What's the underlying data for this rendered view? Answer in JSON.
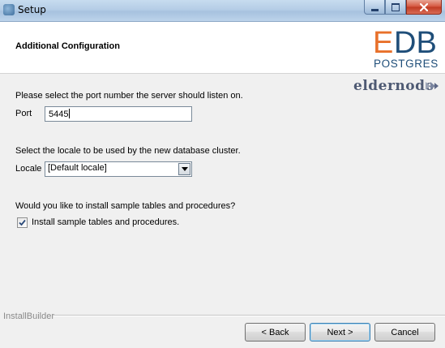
{
  "window": {
    "title": "Setup",
    "app_icon": "postgres-elephant-icon"
  },
  "header": {
    "title": "Additional Configuration",
    "logo": {
      "top": "EDB",
      "bottom": "POSTGRES",
      "colors": {
        "E": "#e8702a",
        "DB": "#1f4e79"
      }
    }
  },
  "watermark": {
    "text": "eldernode"
  },
  "port": {
    "prompt": "Please select the port number the server should listen on.",
    "label": "Port",
    "value": "5445"
  },
  "locale": {
    "prompt": "Select the locale to be used by the new database cluster.",
    "label": "Locale",
    "selected": "[Default locale]"
  },
  "samples": {
    "prompt": "Would you like to install sample tables and procedures?",
    "checkbox_label": "Install sample tables and procedures.",
    "checked": true
  },
  "footer": {
    "brand": "InstallBuilder",
    "back_label": "< Back",
    "next_label": "Next >",
    "cancel_label": "Cancel"
  }
}
